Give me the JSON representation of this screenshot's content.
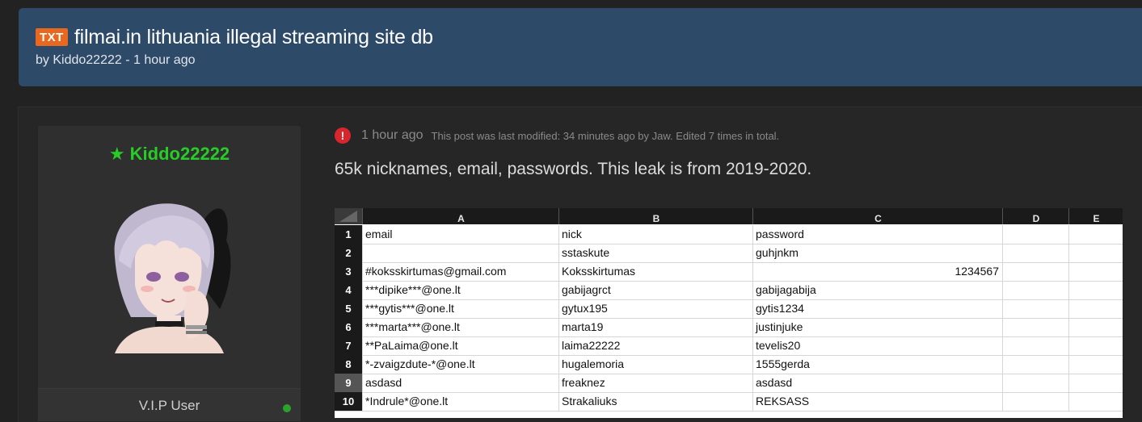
{
  "thread": {
    "badge": "TXT",
    "title": "filmai.in lithuania illegal streaming site db",
    "byline": "by Kiddo22222 - 1 hour ago"
  },
  "user": {
    "username": "Kiddo22222",
    "rank": "V.I.P User",
    "colors": {
      "username": "#27cc27",
      "online": "#2aa32a"
    }
  },
  "post": {
    "time": "1 hour ago",
    "edit_note": "This post was last modified: 34 minutes ago by Jaw. Edited 7 times in total.",
    "body": "65k nicknames, email, passwords. This leak is from 2019-2020."
  },
  "spreadsheet": {
    "columns": [
      "A",
      "B",
      "C",
      "D",
      "E"
    ],
    "selected_row": 9,
    "rows": [
      {
        "n": "1",
        "a": "email",
        "b": "nick",
        "c": "password",
        "c_num": false
      },
      {
        "n": "2",
        "a": "",
        "b": "sstaskute",
        "c": "guhjnkm",
        "c_num": false
      },
      {
        "n": "3",
        "a": "#koksskirtumas@gmail.com",
        "b": "Koksskirtumas",
        "c": "1234567",
        "c_num": true
      },
      {
        "n": "4",
        "a": "***dipike***@one.lt",
        "b": "gabijagrct",
        "c": "gabijagabija",
        "c_num": false
      },
      {
        "n": "5",
        "a": "***gytis***@one.lt",
        "b": "gytux195",
        "c": "gytis1234",
        "c_num": false
      },
      {
        "n": "6",
        "a": "***marta***@one.lt",
        "b": "marta19",
        "c": "justinjuke",
        "c_num": false
      },
      {
        "n": "7",
        "a": "**PaLaima@one.lt",
        "b": "laima22222",
        "c": "tevelis20",
        "c_num": false
      },
      {
        "n": "8",
        "a": "*-zvaigzdute-*@one.lt",
        "b": "hugalemoria",
        "c": "1555gerda",
        "c_num": false
      },
      {
        "n": "9",
        "a": "asdasd",
        "b": "freaknez",
        "c": "asdasd",
        "c_num": false
      },
      {
        "n": "10",
        "a": "*Indrule*@one.lt",
        "b": "Strakaliuks",
        "c": "REKSASS",
        "c_num": false
      }
    ]
  },
  "icons": {
    "alert": "exclamation-circle-icon",
    "star": "star-icon"
  }
}
